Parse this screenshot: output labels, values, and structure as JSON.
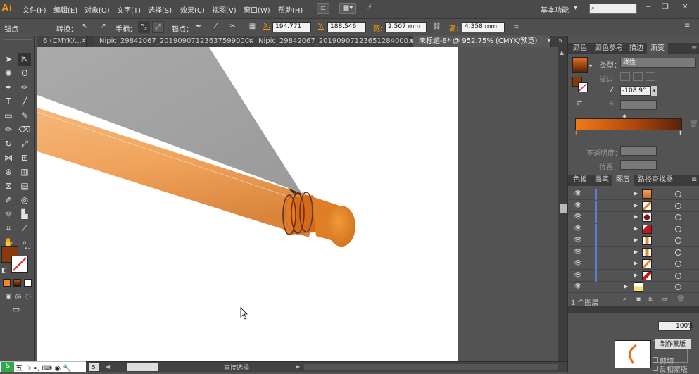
{
  "app": {
    "logo": "Ai"
  },
  "menu": [
    "文件(F)",
    "编辑(E)",
    "对象(O)",
    "文字(T)",
    "选择(S)",
    "效果(C)",
    "视图(V)",
    "窗口(W)",
    "帮助(H)"
  ],
  "workspace": "基本功能",
  "control": {
    "selection_label": "锚点",
    "convert_label": "转换：",
    "handle_label": "手柄：",
    "anchor_label": "锚点：",
    "x_label": "X:",
    "x_value": "194.771",
    "y_label": "Y:",
    "y_value": "188.546",
    "w_label": "宽:",
    "w_value": "2.507 mm",
    "h_label": "高:",
    "h_value": "4.358 mm"
  },
  "tabs": [
    {
      "label": "6 (CMYK/...",
      "active": false
    },
    {
      "label": "Nipic_29842067_20190907123637599000.ai*",
      "active": false
    },
    {
      "label": "Nipic_29842067_20190907123651284000.ai*",
      "active": false
    },
    {
      "label": "未标题-8* @ 952.75% (CMYK/预览)",
      "active": true
    }
  ],
  "panel_top": {
    "tabs": [
      "颜色",
      "颜色参考",
      "描边",
      "渐变"
    ],
    "type_label": "类型：",
    "type_value": "线性",
    "stroke_label": "描边",
    "angle_value": "-108.9°",
    "opacity_label": "不透明度：",
    "position_label": "位置：",
    "gradient_start": "#f07a1a",
    "gradient_end": "#5a2208"
  },
  "panel_layers": {
    "tabs": [
      "色板",
      "画笔",
      "图层",
      "路径查找器"
    ],
    "footer": "1 个图层",
    "rows": [
      {
        "thumb": "orange-shape"
      },
      {
        "thumb": "orange-stripe"
      },
      {
        "thumb": "dark-red-shape"
      },
      {
        "thumb": "red-shape"
      },
      {
        "thumb": "orange-tube"
      },
      {
        "thumb": "orange-tube"
      },
      {
        "thumb": "orange-stripe"
      },
      {
        "thumb": "red-stripe"
      }
    ]
  },
  "panel_bottom": {
    "opacity_value": "100%",
    "mask_button": "制作蒙版",
    "clip_label": "剪切",
    "invert_label": "反相蒙版"
  },
  "status": {
    "tool": "直接选择",
    "zoom": "5"
  },
  "colors": {
    "fill": "#8a3a0a",
    "stroke": "#ffffff",
    "accent": "#ff9a00",
    "pencil": "#f0a05a",
    "band": "#d56a18"
  }
}
